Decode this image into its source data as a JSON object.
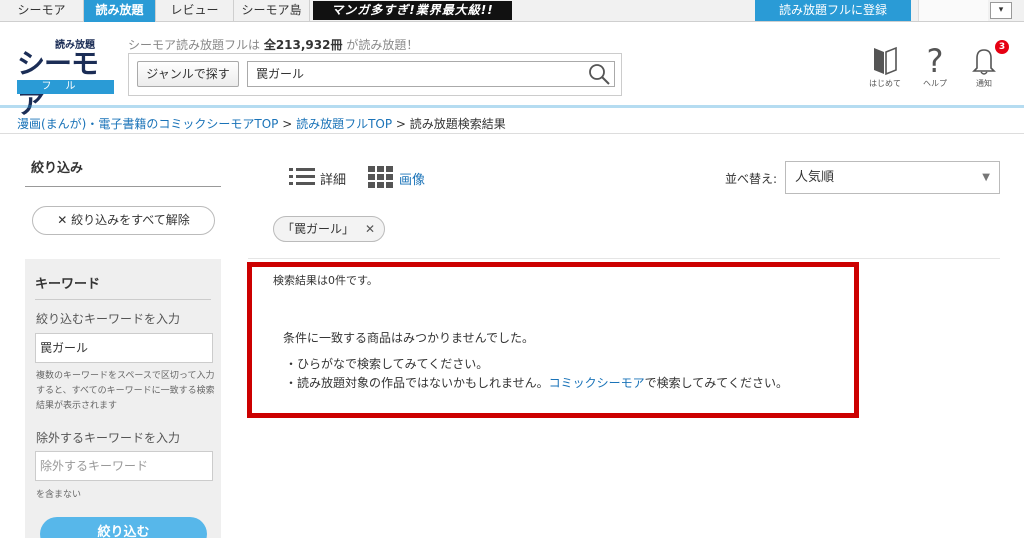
{
  "topnav": {
    "tabs": [
      "シーモア",
      "読み放題",
      "レビュー",
      "シーモア島"
    ],
    "banner": "マンガ多すぎ!業界最大級!!",
    "register": "読み放題フルに登録",
    "select": "▾"
  },
  "header": {
    "logo_small": "読み放題",
    "logo_main": "シーモア",
    "logo_sub": "フル",
    "tagline_pre": "シーモア読み放題フルは ",
    "tagline_count": "全213,932冊",
    "tagline_post": " が読み放題！",
    "genre_button": "ジャンルで探す",
    "search_value": "罠ガール",
    "icons": [
      {
        "name": "book-icon",
        "label": "はじめて"
      },
      {
        "name": "question-icon",
        "label": "ヘルプ"
      },
      {
        "name": "bell-icon",
        "label": "通知"
      }
    ],
    "badge": "3"
  },
  "breadcrumb": {
    "items": [
      "漫画(まんが)・電子書籍のコミックシーモアTOP",
      "読み放題フルTOP"
    ],
    "separator": " > ",
    "current": "読み放題検索結果"
  },
  "sidebar": {
    "title": "絞り込み",
    "clear_all": "✕ 絞り込みをすべて解除",
    "keyword_title": "キーワード",
    "include_label": "絞り込むキーワードを入力",
    "include_value": "罠ガール",
    "include_help": "複数のキーワードをスペースで区切って入力すると、すべてのキーワードに一致する検索結果が表示されます",
    "exclude_label": "除外するキーワードを入力",
    "exclude_placeholder": "除外するキーワード",
    "exclude_note": "を含まない",
    "submit": "絞り込む"
  },
  "main": {
    "view_detail": "詳細",
    "view_image": "画像",
    "sort_label": "並べ替え:",
    "sort_value": "人気順",
    "sort_caret": "▼",
    "chip_label": "「罠ガール」",
    "chip_close": "✕",
    "result_count": "検索結果は0件です。",
    "no_match": "条件に一致する商品はみつかりませんでした。",
    "hint1": "・ひらがなで検索してみてください。",
    "hint2_pre": "・読み放題対象の作品ではないかもしれません。",
    "hint2_link": "コミックシーモア",
    "hint2_post": "で検索してみてください。"
  },
  "colors": {
    "accent": "#2a9bd6",
    "link": "#1a73b8",
    "highlight_frame": "#cc0000",
    "badge": "#e60012"
  }
}
